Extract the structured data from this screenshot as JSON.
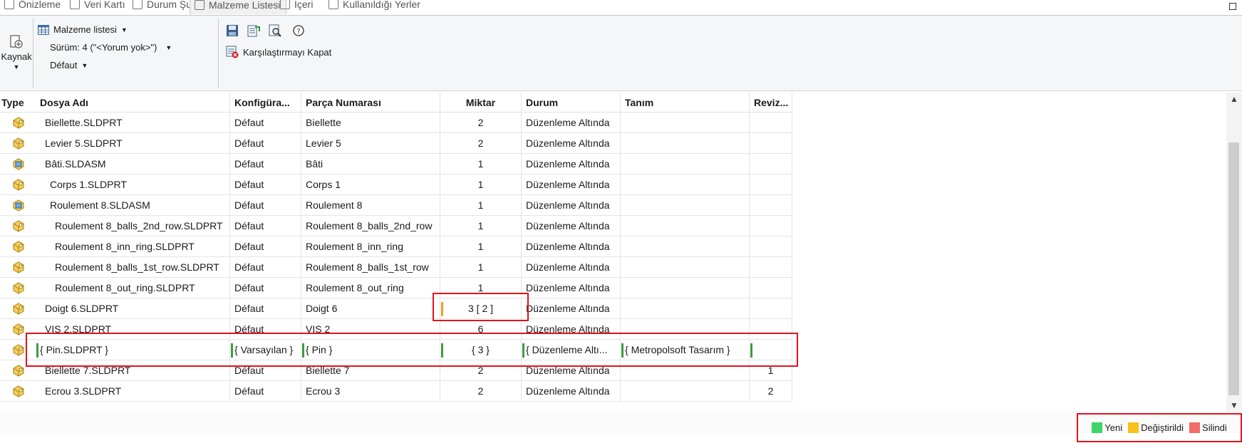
{
  "tabs": [
    {
      "label": "Önizleme"
    },
    {
      "label": "Veri Kartı"
    },
    {
      "label": "Durum Şu"
    },
    {
      "label": "Malzeme Listesi"
    },
    {
      "label": "İçeri"
    },
    {
      "label": "Kullanıldığı Yerler"
    }
  ],
  "toolbar": {
    "source_label": "Kaynak",
    "bom_label": "Malzeme listesi",
    "version_label": "Sürüm: 4 (\"<Yorum yok>\")",
    "config_label": "Défaut",
    "close_compare_label": "Karşılaştırmayı Kapat",
    "icons": [
      "save-icon",
      "export-icon",
      "preview-icon",
      "help-icon"
    ]
  },
  "table": {
    "headers": [
      "Type",
      "Dosya Adı",
      "Konfigüra...",
      "Parça Numarası",
      "Miktar",
      "Durum",
      "Tanım",
      "Reviz..."
    ],
    "rows": [
      {
        "type": "part",
        "file": "Biellette.SLDPRT",
        "indent": 1,
        "config": "Défaut",
        "part": "Biellette",
        "qty": "2",
        "state": "Düzenleme Altında",
        "desc": "",
        "rev": ""
      },
      {
        "type": "part",
        "file": "Levier 5.SLDPRT",
        "indent": 1,
        "config": "Défaut",
        "part": "Levier 5",
        "qty": "2",
        "state": "Düzenleme Altında",
        "desc": "",
        "rev": ""
      },
      {
        "type": "assembly",
        "file": "Bâti.SLDASM",
        "indent": 1,
        "config": "Défaut",
        "part": "Bâti",
        "qty": "1",
        "state": "Düzenleme Altında",
        "desc": "",
        "rev": ""
      },
      {
        "type": "part",
        "file": "Corps 1.SLDPRT",
        "indent": 2,
        "config": "Défaut",
        "part": "Corps 1",
        "qty": "1",
        "state": "Düzenleme Altında",
        "desc": "",
        "rev": ""
      },
      {
        "type": "assembly",
        "file": "Roulement 8.SLDASM",
        "indent": 2,
        "config": "Défaut",
        "part": "Roulement 8",
        "qty": "1",
        "state": "Düzenleme Altında",
        "desc": "",
        "rev": ""
      },
      {
        "type": "part",
        "file": "Roulement 8_balls_2nd_row.SLDPRT",
        "indent": 3,
        "config": "Défaut",
        "part": "Roulement 8_balls_2nd_row",
        "qty": "1",
        "state": "Düzenleme Altında",
        "desc": "",
        "rev": ""
      },
      {
        "type": "part",
        "file": "Roulement 8_inn_ring.SLDPRT",
        "indent": 3,
        "config": "Défaut",
        "part": "Roulement 8_inn_ring",
        "qty": "1",
        "state": "Düzenleme Altında",
        "desc": "",
        "rev": ""
      },
      {
        "type": "part",
        "file": "Roulement 8_balls_1st_row.SLDPRT",
        "indent": 3,
        "config": "Défaut",
        "part": "Roulement 8_balls_1st_row",
        "qty": "1",
        "state": "Düzenleme Altında",
        "desc": "",
        "rev": ""
      },
      {
        "type": "part",
        "file": "Roulement 8_out_ring.SLDPRT",
        "indent": 3,
        "config": "Défaut",
        "part": "Roulement 8_out_ring",
        "qty": "1",
        "state": "Düzenleme Altında",
        "desc": "",
        "rev": ""
      },
      {
        "type": "part",
        "file": "Doigt 6.SLDPRT",
        "indent": 1,
        "config": "Défaut",
        "part": "Doigt 6",
        "qty": "3 [ 2 ]",
        "qty_status": "changed",
        "state": "Düzenleme Altında",
        "desc": "",
        "rev": ""
      },
      {
        "type": "part",
        "file": "VIS 2.SLDPRT",
        "indent": 1,
        "config": "Défaut",
        "part": "VIS 2",
        "qty": "6",
        "state": "Düzenleme Altında",
        "desc": "",
        "rev": ""
      },
      {
        "type": "part",
        "file": "{ Pin.SLDPRT }",
        "indent": 0,
        "status": "new",
        "config": "{ Varsayılan }",
        "part": "{ Pin }",
        "qty": "{ 3 }",
        "state": "{ Düzenleme Altı...",
        "desc": "{ Metropolsoft Tasarım }",
        "rev": ""
      },
      {
        "type": "part",
        "file": "Biellette 7.SLDPRT",
        "indent": 1,
        "config": "Défaut",
        "part": "Biellette 7",
        "qty": "2",
        "state": "Düzenleme Altında",
        "desc": "",
        "rev": "1"
      },
      {
        "type": "part",
        "file": "Ecrou 3.SLDPRT",
        "indent": 1,
        "config": "Défaut",
        "part": "Ecrou 3",
        "qty": "2",
        "state": "Düzenleme Altında",
        "desc": "",
        "rev": "2"
      }
    ]
  },
  "legend": [
    {
      "label": "Yeni",
      "color": "#3fd46a"
    },
    {
      "label": "Değiştirildi",
      "color": "#f7c21a"
    },
    {
      "label": "Silindi",
      "color": "#f26b6b"
    }
  ],
  "colors": {
    "highlight": "#e0141e",
    "new_marker": "#3f9a3f",
    "changed_marker": "#e7a321",
    "part_icon": "#e8b83a"
  }
}
